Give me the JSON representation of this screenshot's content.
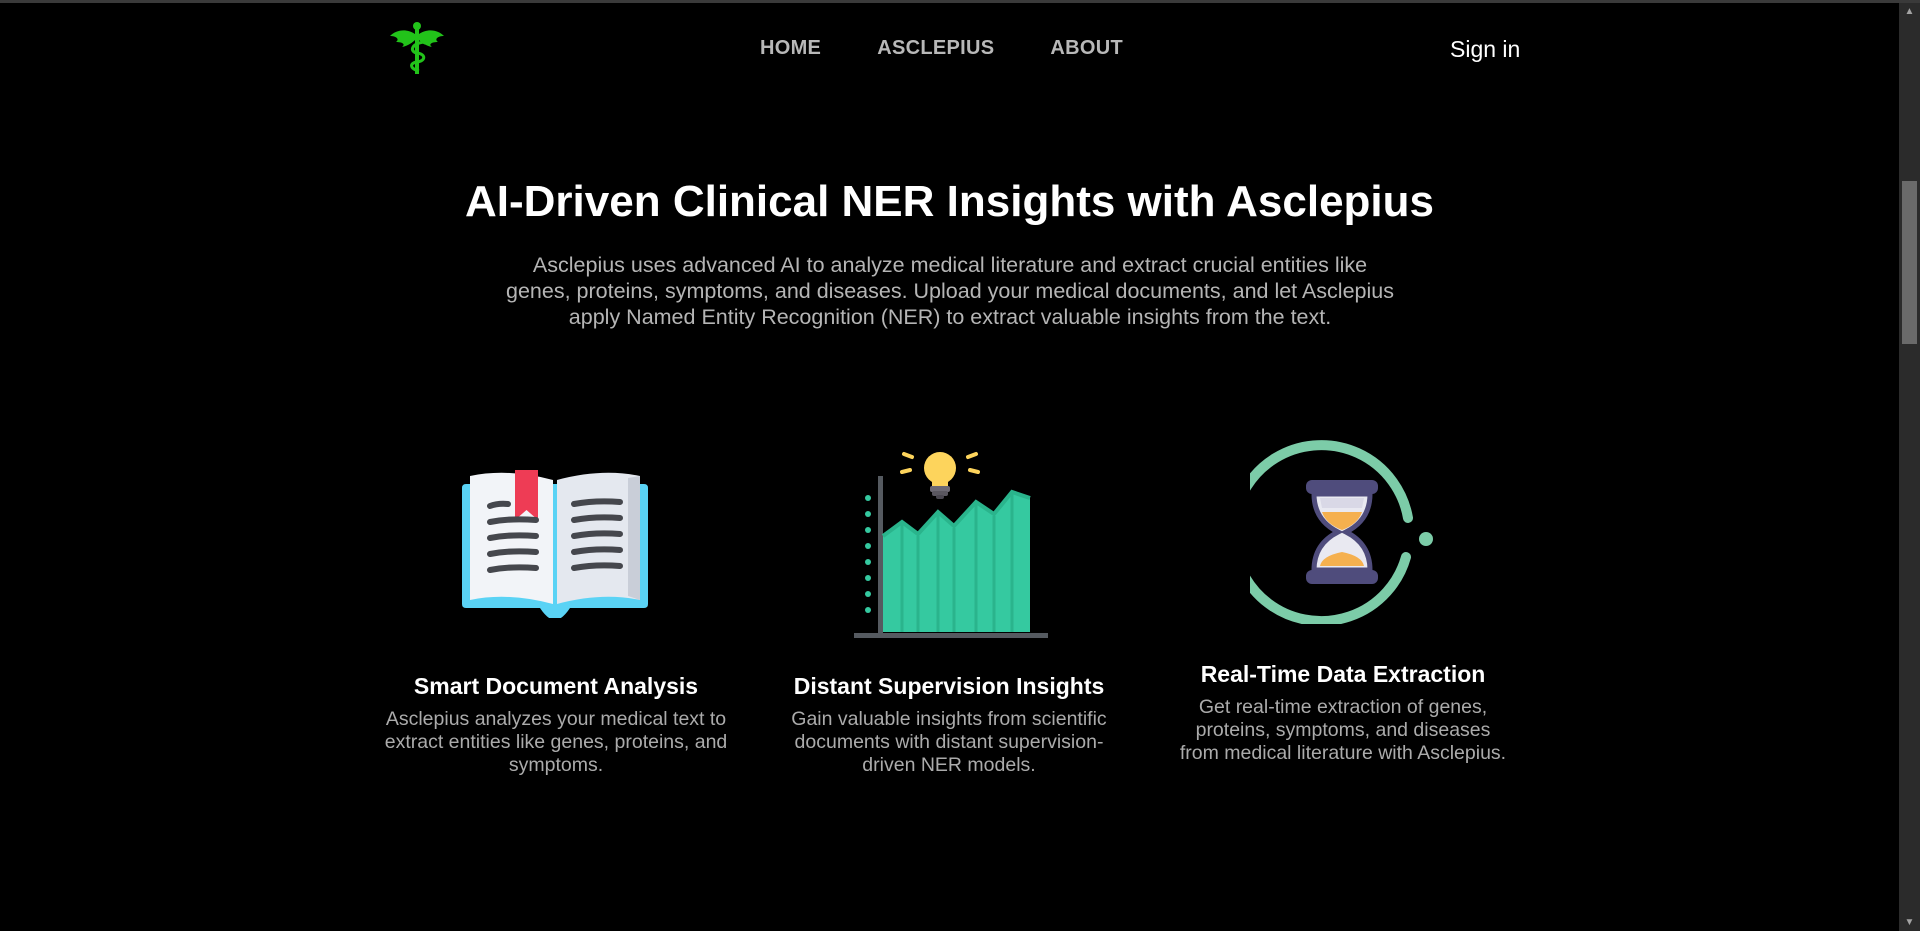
{
  "nav": {
    "logo_icon": "caduceus-icon",
    "links": [
      "HOME",
      "ASCLEPIUS",
      "ABOUT"
    ],
    "signin": "Sign in"
  },
  "hero": {
    "title": "AI-Driven Clinical NER Insights with Asclepius",
    "description": "Asclepius uses advanced AI to analyze medical literature and extract crucial entities like genes, proteins, symptoms, and diseases. Upload your medical documents, and let Asclepius apply Named Entity Recognition (NER) to extract valuable insights from the text."
  },
  "features": [
    {
      "icon": "open-book-icon",
      "title": "Smart Document Analysis",
      "description": "Asclepius analyzes your medical text to extract entities like genes, proteins, and symptoms."
    },
    {
      "icon": "growth-chart-lightbulb-icon",
      "title": "Distant Supervision Insights",
      "description": "Gain valuable insights from scientific documents with distant supervision-driven NER models."
    },
    {
      "icon": "hourglass-timer-icon",
      "title": "Real-Time Data Extraction",
      "description": "Get real-time extraction of genes, proteins, symptoms, and diseases from medical literature with Asclepius."
    }
  ],
  "colors": {
    "background": "#000000",
    "logo_green": "#22c31a",
    "chart_green": "#35c9a0",
    "ring_green": "#7ccca8",
    "book_blue": "#5ad3f5"
  }
}
